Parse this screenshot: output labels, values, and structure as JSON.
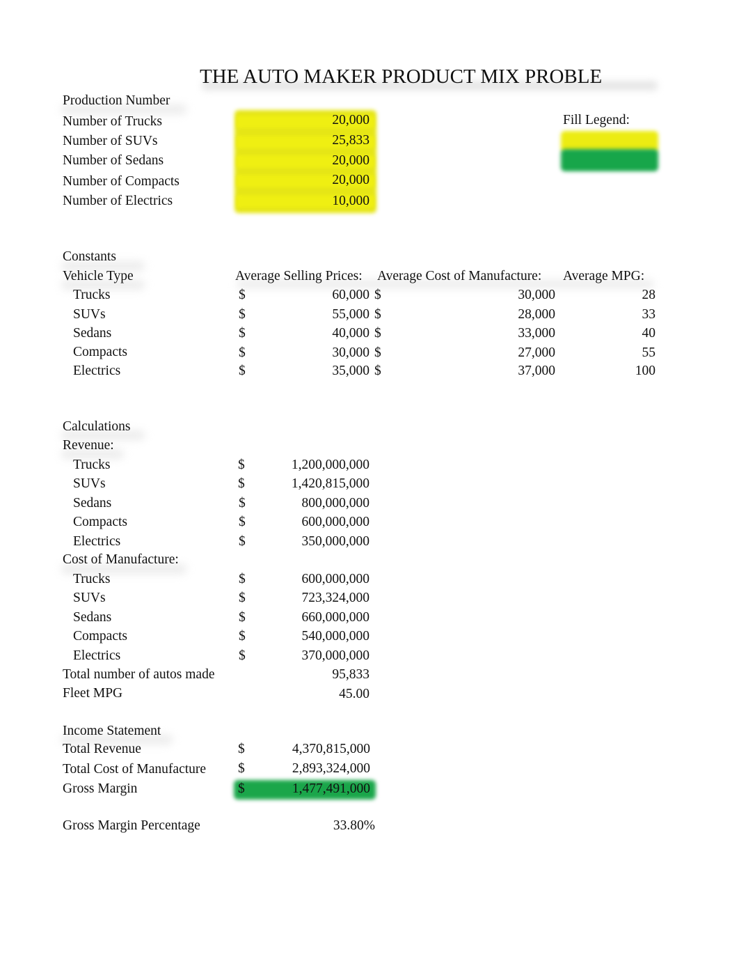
{
  "title": "THE AUTO MAKER PRODUCT MIX PROBLE",
  "production": {
    "heading": "Production Number",
    "rows": [
      {
        "label": "Number of Trucks",
        "value": "20,000"
      },
      {
        "label": "Number of SUVs",
        "value": "25,833"
      },
      {
        "label": "Number of Sedans",
        "value": "20,000"
      },
      {
        "label": "Number of Compacts",
        "value": "20,000"
      },
      {
        "label": "Number of Electrics",
        "value": "10,000"
      }
    ]
  },
  "legend": {
    "label": "Fill Legend:",
    "colors": {
      "input": "#ecec12",
      "output": "#17a64a"
    }
  },
  "constants": {
    "heading": "Constants",
    "col_vehicle": "Vehicle Type",
    "col_price": "Average Selling Prices:",
    "col_cost": "Average Cost of Manufacture:",
    "col_mpg": "Average MPG:",
    "currency": "$",
    "rows": [
      {
        "type": "Trucks",
        "price": "60,000",
        "cost": "30,000",
        "mpg": "28"
      },
      {
        "type": "SUVs",
        "price": "55,000",
        "cost": "28,000",
        "mpg": "33"
      },
      {
        "type": "Sedans",
        "price": "40,000",
        "cost": "33,000",
        "mpg": "40"
      },
      {
        "type": "Compacts",
        "price": "30,000",
        "cost": "27,000",
        "mpg": "55"
      },
      {
        "type": "Electrics",
        "price": "35,000",
        "cost": "37,000",
        "mpg": "100"
      }
    ]
  },
  "calculations": {
    "heading": "Calculations",
    "revenue_heading": "Revenue:",
    "currency": "$",
    "revenue": [
      {
        "type": "Trucks",
        "value": "1,200,000,000"
      },
      {
        "type": "SUVs",
        "value": "1,420,815,000"
      },
      {
        "type": "Sedans",
        "value": "800,000,000"
      },
      {
        "type": "Compacts",
        "value": "600,000,000"
      },
      {
        "type": "Electrics",
        "value": "350,000,000"
      }
    ],
    "cost_heading": "Cost of Manufacture:",
    "cost": [
      {
        "type": "Trucks",
        "value": "600,000,000"
      },
      {
        "type": "SUVs",
        "value": "723,324,000"
      },
      {
        "type": "Sedans",
        "value": "660,000,000"
      },
      {
        "type": "Compacts",
        "value": "540,000,000"
      },
      {
        "type": "Electrics",
        "value": "370,000,000"
      }
    ],
    "total_autos_label": "Total number of autos made",
    "total_autos": "95,833",
    "fleet_mpg_label": "Fleet MPG",
    "fleet_mpg": "45.00"
  },
  "income": {
    "heading": "Income Statement",
    "currency": "$",
    "total_revenue_label": "Total Revenue",
    "total_revenue": "4,370,815,000",
    "total_cost_label": "Total Cost of Manufacture",
    "total_cost": "2,893,324,000",
    "gross_margin_label": "Gross Margin",
    "gross_margin": "1,477,491,000",
    "gm_pct_label": "Gross Margin Percentage",
    "gm_pct": "33.80%"
  }
}
